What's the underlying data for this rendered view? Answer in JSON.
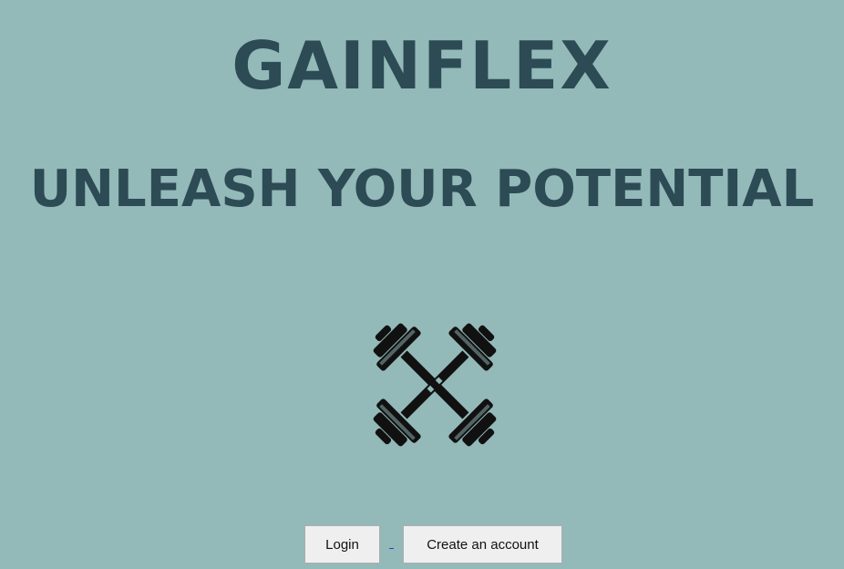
{
  "header": {
    "brand": "GAINFLEX",
    "tagline": "UNLEASH YOUR POTENTIAL"
  },
  "logo": {
    "icon": "crossed-dumbbells-icon"
  },
  "actions": {
    "login_label": "Login",
    "create_account_label": "Create an account"
  },
  "colors": {
    "background": "#93b9b8",
    "heading": "#2c4b55",
    "icon": "#111111"
  }
}
